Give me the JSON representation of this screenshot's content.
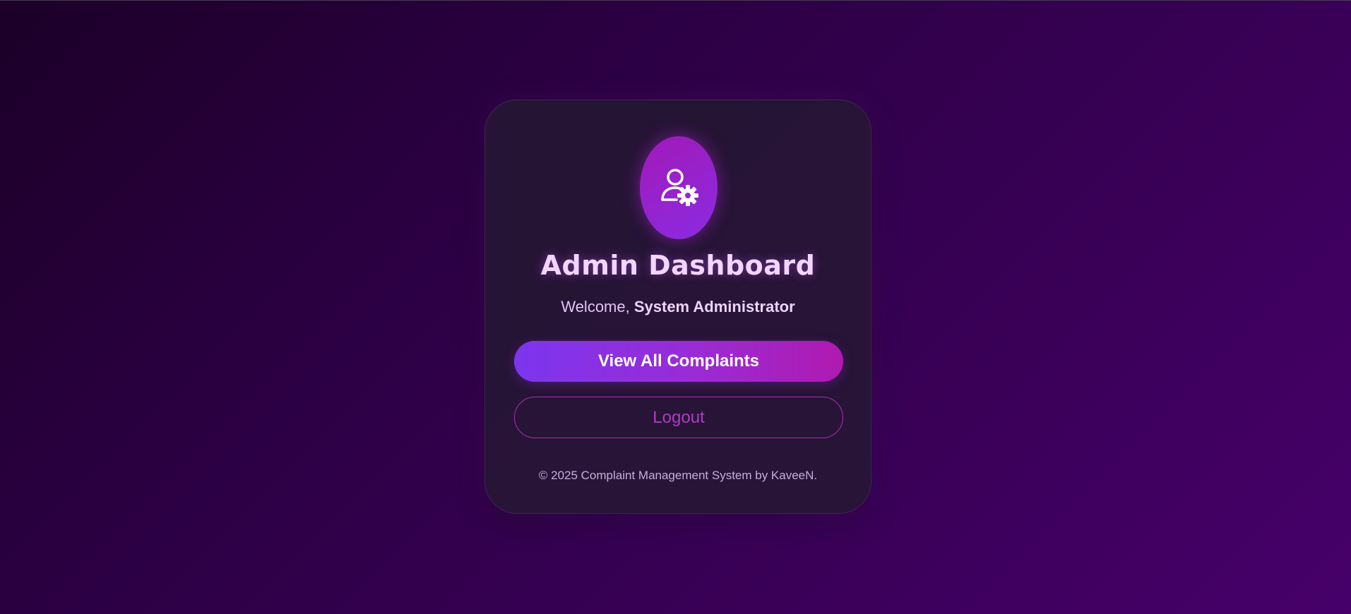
{
  "app": {
    "title": "Admin Dashboard",
    "welcome_prefix": "Welcome, ",
    "user_name": "System Administrator"
  },
  "avatar": {
    "icon": "user-gear-icon"
  },
  "actions": {
    "view_complaints_label": "View All Complaints",
    "logout_label": "Logout"
  },
  "footer": {
    "text": "© 2025 Complaint Management System by KaveeN."
  },
  "colors": {
    "accent_start": "#7b36ee",
    "accent_end": "#b01aaf",
    "title_text": "#f2d6ff",
    "outline_button": "#b02ab8"
  }
}
